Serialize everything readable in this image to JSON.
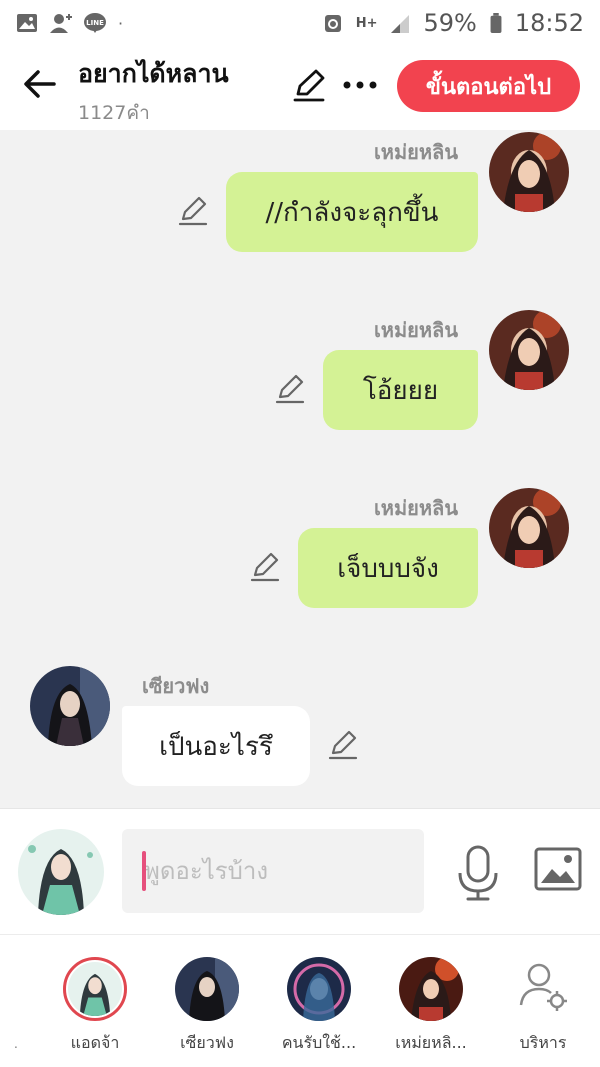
{
  "status_bar": {
    "battery": "59%",
    "time": "18:52",
    "net": "H+",
    "dot": "·"
  },
  "header": {
    "title": "อยากได้หลาน",
    "subtitle": "1127คำ",
    "next_button": "ขั้นตอนต่อไป"
  },
  "messages": [
    {
      "name": "เหม่ยหลิน",
      "text": "//กำลังจะลุกขึ้น",
      "side": "right"
    },
    {
      "name": "เหม่ยหลิน",
      "text": "โอ้ยยย",
      "side": "right"
    },
    {
      "name": "เหม่ยหลิน",
      "text": "เจ็บบบจัง",
      "side": "right"
    },
    {
      "name": "เซียวฟง",
      "text": "เป็นอะไรรึ",
      "side": "left"
    }
  ],
  "composer": {
    "placeholder": "พูดอะไรบ้าง"
  },
  "bottom_tabs": [
    {
      "label": "แอดจ้า",
      "active": true
    },
    {
      "label": "เซียวฟง",
      "active": false
    },
    {
      "label": "คนรับใช้...",
      "active": false
    },
    {
      "label": "เหม่ยหลิ...",
      "active": false
    },
    {
      "label": "บริหาร",
      "active": false
    }
  ],
  "colors": {
    "accent": "#f2434f",
    "bubble_right": "#d4f295",
    "bubble_left": "#ffffff",
    "background": "#f2f2f2"
  },
  "icons": [
    "gallery-icon",
    "add-contact-icon",
    "line-icon",
    "battery-saver-icon",
    "signal-icon",
    "battery-icon",
    "back-arrow-icon",
    "edit-pen-icon",
    "more-icon",
    "mic-icon",
    "image-icon",
    "manage-user-icon"
  ]
}
